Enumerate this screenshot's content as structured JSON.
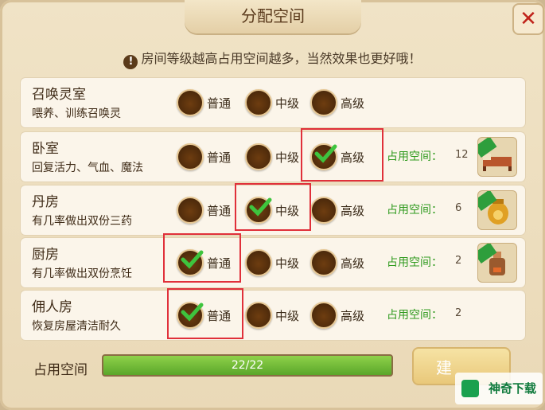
{
  "window": {
    "title": "分配空间",
    "close_label": "✕"
  },
  "notice": {
    "icon": "exclamation-icon",
    "text": "房间等级越高占用空间越多，当然效果也更好哦！"
  },
  "rooms": [
    {
      "name": "召唤灵室",
      "desc": "喂养、训练召唤灵",
      "options": [
        "普通",
        "中级",
        "高级"
      ],
      "selected": null,
      "space_label": "",
      "space_value": "",
      "has_thumb": false
    },
    {
      "name": "卧室",
      "desc": "回复活力、气血、魔法",
      "options": [
        "普通",
        "中级",
        "高级"
      ],
      "selected": 2,
      "space_label": "占用空间：",
      "space_value": "12",
      "has_thumb": true,
      "thumb_icon": "bed-icon"
    },
    {
      "name": "丹房",
      "desc": "有几率做出双份三药",
      "options": [
        "普通",
        "中级",
        "高级"
      ],
      "selected": 1,
      "space_label": "占用空间：",
      "space_value": "6",
      "has_thumb": true,
      "thumb_icon": "furnace-icon"
    },
    {
      "name": "厨房",
      "desc": "有几率做出双份烹饪",
      "options": [
        "普通",
        "中级",
        "高级"
      ],
      "selected": 0,
      "space_label": "占用空间：",
      "space_value": "2",
      "has_thumb": true,
      "thumb_icon": "stove-icon"
    },
    {
      "name": "佣人房",
      "desc": "恢复房屋清洁耐久",
      "options": [
        "普通",
        "中级",
        "高级"
      ],
      "selected": 0,
      "space_label": "占用空间：",
      "space_value": "2",
      "has_thumb": false
    }
  ],
  "footer": {
    "label": "占用空间",
    "progress_text": "22/22",
    "progress_fraction": 1.0,
    "build_label": "建"
  },
  "watermark": {
    "text": "神奇下载"
  },
  "colors": {
    "accent_green": "#2f9a1e",
    "highlight_red": "#e0303a",
    "radio_brown": "#5a2f0d"
  }
}
